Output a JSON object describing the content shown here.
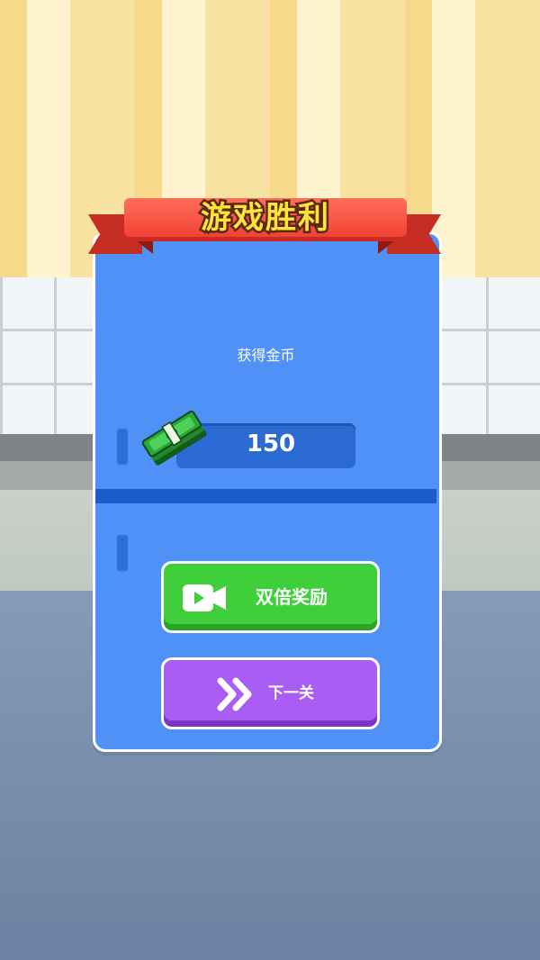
{
  "title": "游戏胜利",
  "reward": {
    "label": "获得金币",
    "amount": "150",
    "icon": "cash-stack-icon"
  },
  "buttons": {
    "double_reward": {
      "label": "双倍奖励",
      "icon": "video-camera-icon",
      "color": "#3fcf3a"
    },
    "next_level": {
      "label": "下一关",
      "icon": "double-chevron-right-icon",
      "color": "#a95df3"
    }
  },
  "colors": {
    "panel": "#4f91f6",
    "ribbon": "#ef3e30",
    "title_text": "#ffe23b"
  }
}
